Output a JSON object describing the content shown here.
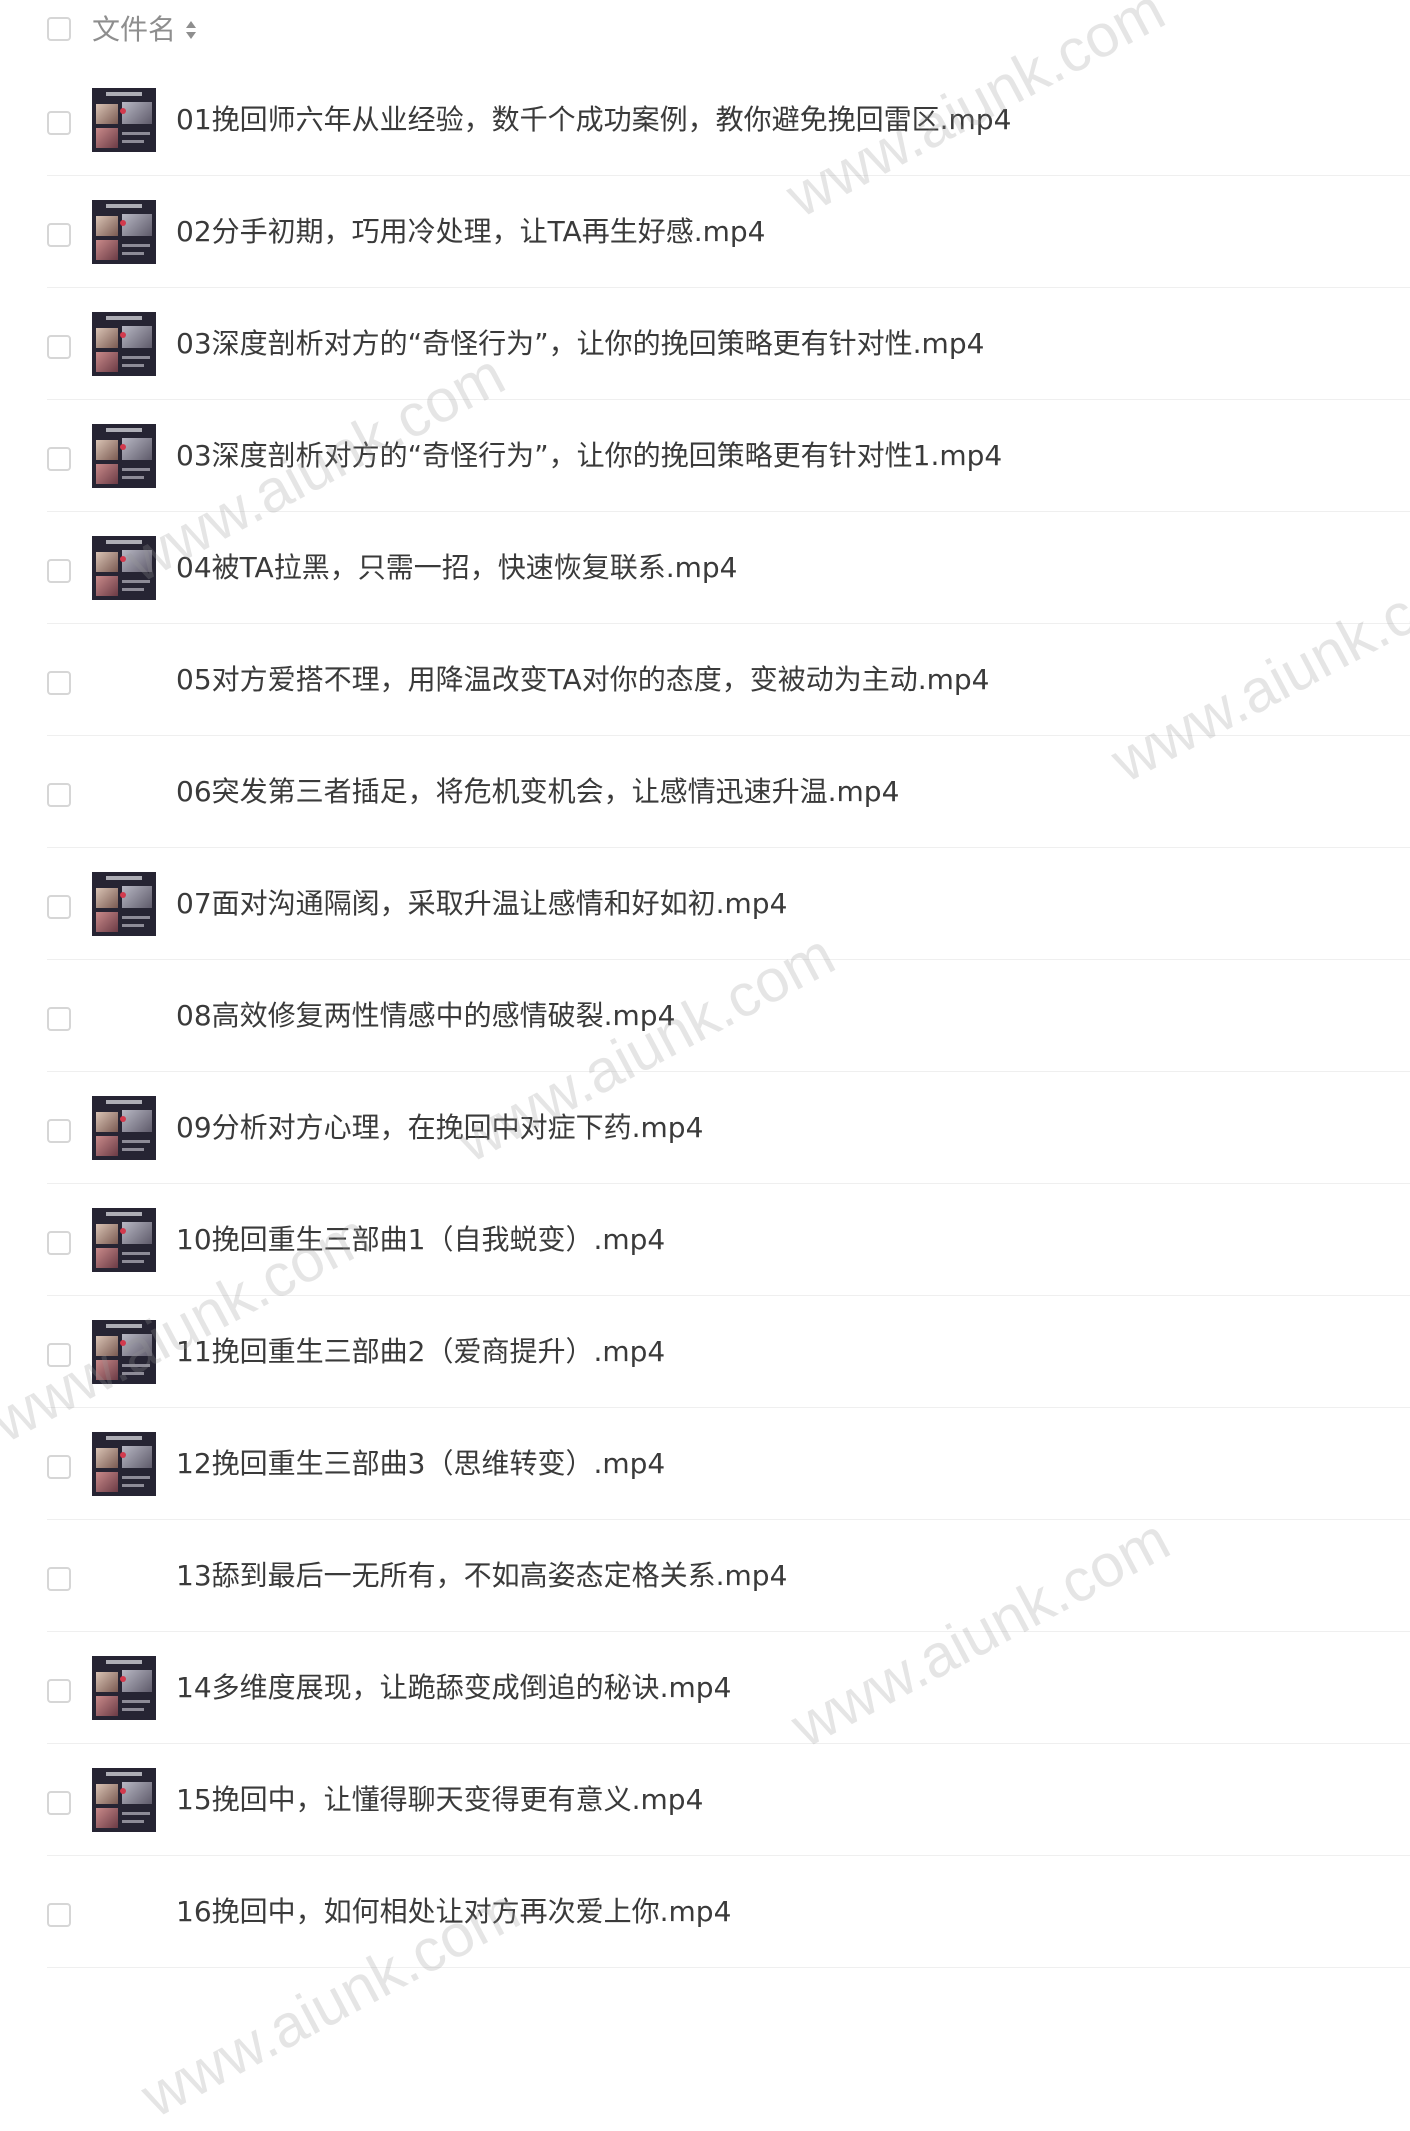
{
  "header": {
    "column_label": "文件名",
    "sort_icon": "sort-updown-icon"
  },
  "files": [
    {
      "name": "01挽回师六年从业经验，数千个成功案例，教你避免挽回雷区.mp4",
      "has_thumb": true
    },
    {
      "name": "02分手初期，巧用冷处理，让TA再生好感.mp4",
      "has_thumb": true
    },
    {
      "name": "03深度剖析对方的“奇怪行为”，让你的挽回策略更有针对性.mp4",
      "has_thumb": true
    },
    {
      "name": "03深度剖析对方的“奇怪行为”，让你的挽回策略更有针对性1.mp4",
      "has_thumb": true
    },
    {
      "name": "04被TA拉黑，只需一招，快速恢复联系.mp4",
      "has_thumb": true
    },
    {
      "name": "05对方爱搭不理，用降温改变TA对你的态度，变被动为主动.mp4",
      "has_thumb": false
    },
    {
      "name": "06突发第三者插足，将危机变机会，让感情迅速升温.mp4",
      "has_thumb": false
    },
    {
      "name": "07面对沟通隔阂，采取升温让感情和好如初.mp4",
      "has_thumb": true
    },
    {
      "name": "08高效修复两性情感中的感情破裂.mp4",
      "has_thumb": false
    },
    {
      "name": "09分析对方心理，在挽回中对症下药.mp4",
      "has_thumb": true
    },
    {
      "name": "10挽回重生三部曲1（自我蜕变）.mp4",
      "has_thumb": true
    },
    {
      "name": "11挽回重生三部曲2（爱商提升）.mp4",
      "has_thumb": true
    },
    {
      "name": "12挽回重生三部曲3（思维转变）.mp4",
      "has_thumb": true
    },
    {
      "name": "13舔到最后一无所有，不如高姿态定格关系.mp4",
      "has_thumb": false
    },
    {
      "name": "14多维度展现，让跪舔变成倒追的秘诀.mp4",
      "has_thumb": true
    },
    {
      "name": "15挽回中，让懂得聊天变得更有意义.mp4",
      "has_thumb": true
    },
    {
      "name": "16挽回中，如何相处让对方再次爱上你.mp4",
      "has_thumb": false
    }
  ],
  "watermark_text": "www.aiunk.com",
  "colors": {
    "text": "#3a3a3a",
    "header_text": "#8e8e8e",
    "divider": "#efefef",
    "checkbox_border": "#d6d6d6",
    "thumb_bg": "#262433"
  }
}
